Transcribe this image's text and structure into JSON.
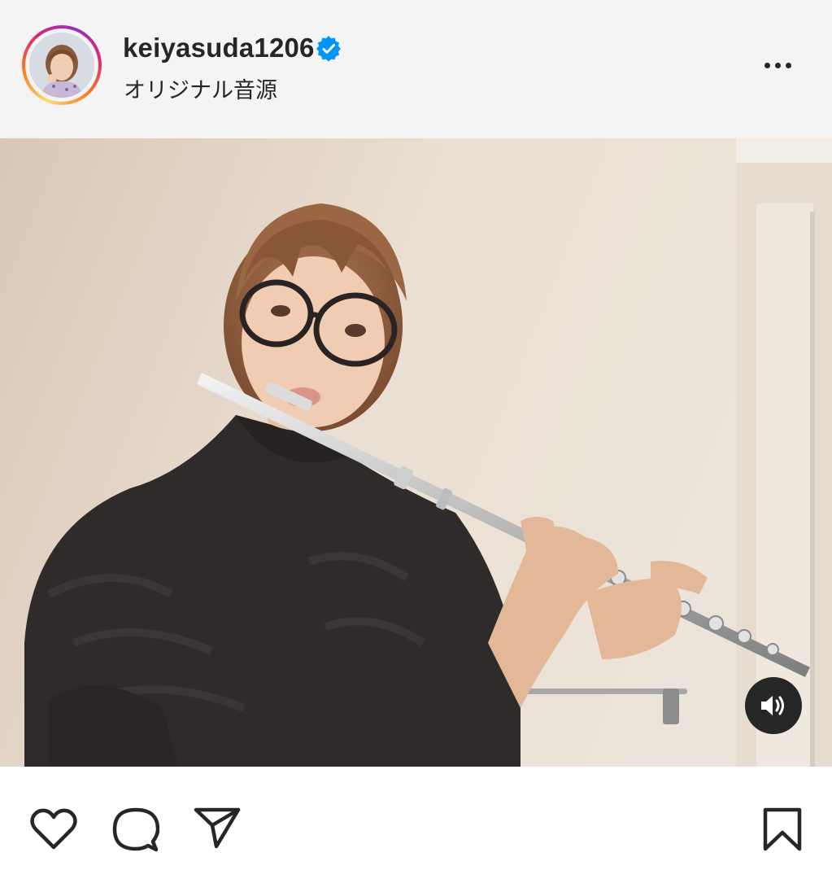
{
  "post": {
    "username": "keiyasuda1206",
    "verified": true,
    "audio_label": "オリジナル音源"
  },
  "icons": {
    "verified": "verified-badge-icon",
    "more": "more-options-icon",
    "volume": "volume-on-icon",
    "like": "heart-icon",
    "comment": "comment-icon",
    "share": "paper-plane-icon",
    "save": "bookmark-icon"
  },
  "colors": {
    "header_bg": "#f4f4f4",
    "text": "#262626",
    "verified": "#0095f6"
  }
}
